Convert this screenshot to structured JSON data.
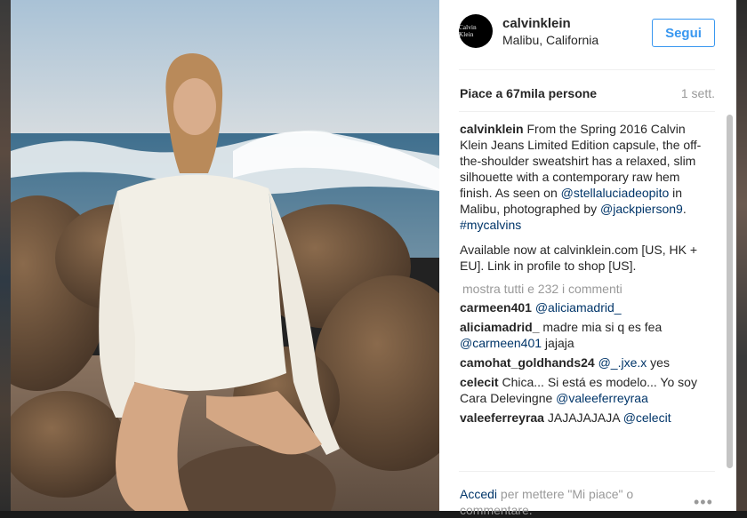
{
  "post": {
    "username": "calvinklein",
    "location": "Malibu, California",
    "avatar_text": "Calvin Klein",
    "follow_label": "Segui",
    "likes": "Piace a 67mila persone",
    "time": "1 sett."
  },
  "caption": {
    "user": "calvinklein",
    "text_1": " From the Spring 2016 Calvin Klein Jeans Limited Edition capsule, the off-the-shoulder sweatshirt has a relaxed, slim silhouette with a contemporary raw hem finish. As seen on ",
    "mention_1": "@stellaluciadeopito",
    "text_2": " in Malibu, photographed by ",
    "mention_2": "@jackpierson9",
    "text_3": ". ",
    "hashtag": "#mycalvins",
    "text_4": "Available now at calvinklein.com [US, HK + EU]. Link in profile to shop [US]."
  },
  "show_all": "mostra tutti e 232 i commenti",
  "comments": [
    {
      "user": "carmeen401",
      "parts": [
        {
          "t": " ",
          "link": false
        },
        {
          "t": "@aliciamadrid_",
          "link": true
        }
      ]
    },
    {
      "user": "aliciamadrid_",
      "parts": [
        {
          "t": " madre mia si q es fea ",
          "link": false
        },
        {
          "t": "@carmeen401",
          "link": true
        },
        {
          "t": " jajaja",
          "link": false
        }
      ]
    },
    {
      "user": "camohat_goldhands24",
      "parts": [
        {
          "t": " ",
          "link": false
        },
        {
          "t": "@_.jxe.x",
          "link": true
        },
        {
          "t": " yes",
          "link": false
        }
      ]
    },
    {
      "user": "celecit",
      "parts": [
        {
          "t": " Chica... Si está es modelo... Yo soy Cara Delevingne ",
          "link": false
        },
        {
          "t": "@valeeferreyraa",
          "link": true
        }
      ]
    },
    {
      "user": "valeeferreyraa",
      "parts": [
        {
          "t": " JAJAJAJAJA ",
          "link": false
        },
        {
          "t": "@celecit",
          "link": true
        }
      ]
    }
  ],
  "footer": {
    "login": "Accedi",
    "text": " per mettere \"Mi piace\" o commentare."
  },
  "icons": {
    "more": "more-options-icon"
  },
  "colors": {
    "link": "#003569",
    "follow": "#3897f0",
    "muted": "#999999"
  }
}
